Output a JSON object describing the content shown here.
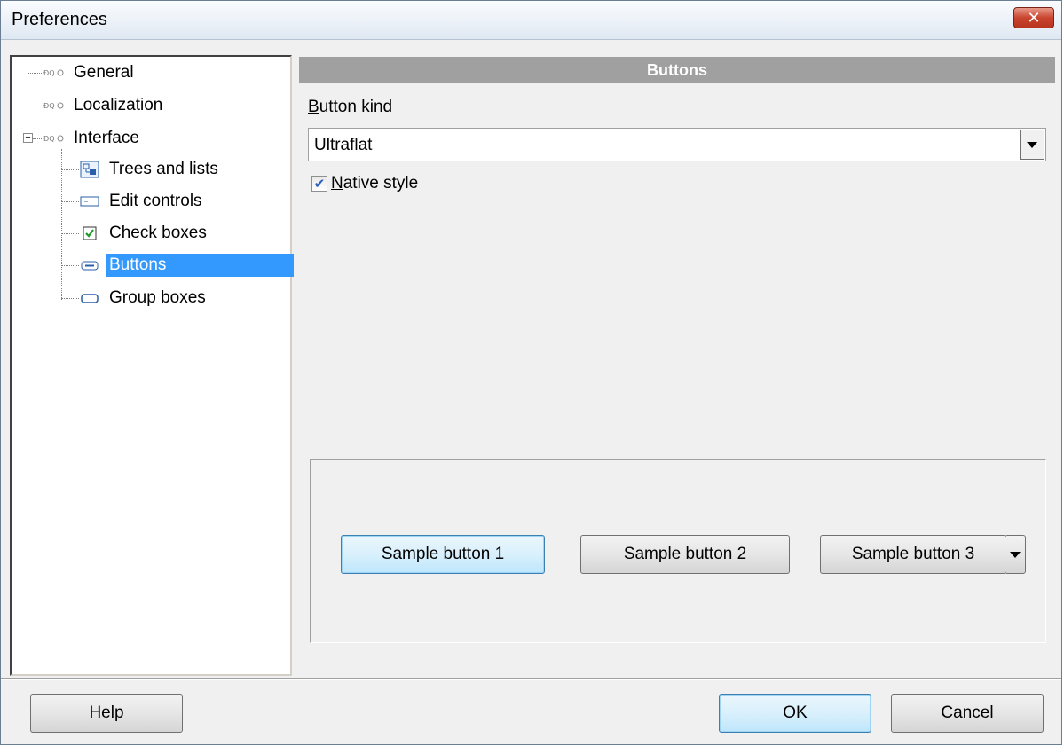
{
  "window": {
    "title": "Preferences"
  },
  "tree": {
    "items": [
      {
        "label": "General"
      },
      {
        "label": "Localization"
      },
      {
        "label": "Interface"
      },
      {
        "label": "Trees and lists"
      },
      {
        "label": "Edit controls"
      },
      {
        "label": "Check boxes"
      },
      {
        "label": "Buttons"
      },
      {
        "label": "Group boxes"
      }
    ]
  },
  "panel": {
    "header": "Buttons",
    "button_kind_label_first": "B",
    "button_kind_label_rest": "utton kind",
    "button_kind_value": "Ultraflat",
    "native_style_first": "N",
    "native_style_rest": "ative style",
    "native_style_checked": true
  },
  "samples": {
    "button1": "Sample button 1",
    "button2": "Sample button 2",
    "button3": "Sample button 3"
  },
  "footer": {
    "help": "Help",
    "ok": "OK",
    "cancel": "Cancel"
  },
  "colors": {
    "selection": "#3399ff",
    "header_bg": "#a0a0a0",
    "close_button": "#c9452f"
  }
}
